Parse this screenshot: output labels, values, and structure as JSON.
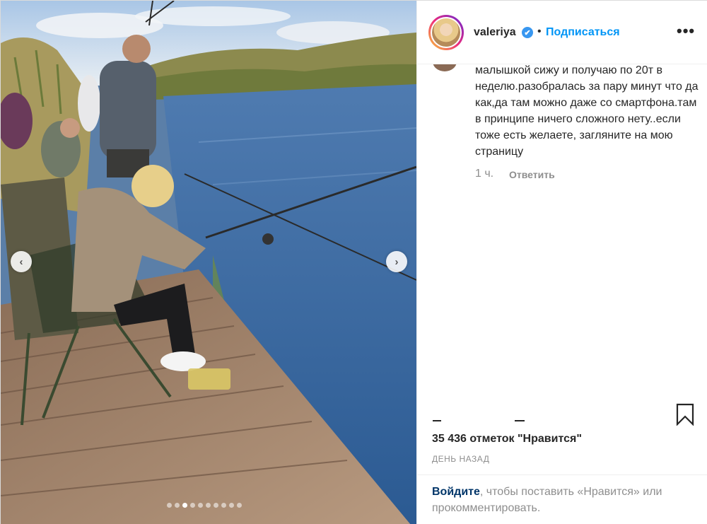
{
  "post": {
    "username": "valeriya",
    "verified_mark": "✔",
    "separator": "•",
    "follow_label": "Подписаться",
    "more_label": "•••"
  },
  "comment": {
    "text": "малышкой сижу и получаю по 20т в неделю.разобралась за пару минут что да как,да там можно даже со смартфона.там в принципе ничего сложного нету..если тоже есть желаете, загляните на мою страницу",
    "time": "1 ч.",
    "reply_label": "Ответить"
  },
  "actions": {
    "likes": "35 436 отметок \"Нравится\"",
    "date": "ДЕНЬ НАЗАД"
  },
  "login": {
    "link": "Войдите",
    "text": ", чтобы поставить «Нравится» или прокомментировать."
  },
  "carousel": {
    "prev_icon": "chevron-left-icon",
    "next_icon": "chevron-right-icon",
    "prev_glyph": "‹",
    "next_glyph": "›",
    "slide_count": 10,
    "active_slide": 2
  },
  "colors": {
    "accent": "#0095f6",
    "link": "#003569",
    "muted": "#8e8e8e",
    "text": "#262626"
  }
}
